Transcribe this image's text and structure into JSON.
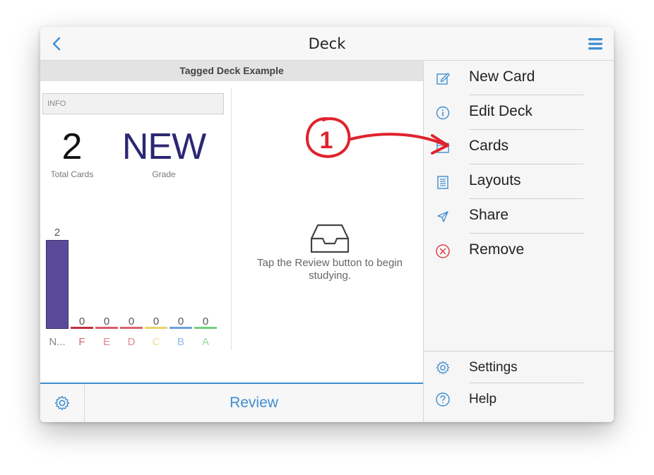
{
  "nav": {
    "title": "Deck",
    "back_icon": "chevron-left-icon",
    "menu_icon": "hamburger-menu-icon",
    "accent": "#3f8ed0"
  },
  "deck": {
    "name": "Tagged Deck Example",
    "info_label": "INFO",
    "total_cards": "2",
    "total_cards_label": "Total Cards",
    "grade": "NEW",
    "grade_label": "Grade"
  },
  "chart_data": {
    "type": "bar",
    "categories": [
      "N...",
      "F",
      "E",
      "D",
      "C",
      "B",
      "A"
    ],
    "values": [
      2,
      0,
      0,
      0,
      0,
      0,
      0
    ],
    "colors": [
      "#5b4a99",
      "#c0303c",
      "#d4606b",
      "#d9646b",
      "#e8d36a",
      "#6aa3e0",
      "#6fd07a"
    ],
    "ylim": [
      0,
      2
    ],
    "title": "",
    "xlabel": "",
    "ylabel": ""
  },
  "empty_state": {
    "icon": "inbox-tray-icon",
    "text": "Tap the Review button to begin studying."
  },
  "bottom_bar": {
    "settings_icon": "gear-icon",
    "review_label": "Review"
  },
  "menu": {
    "items": [
      {
        "label": "New Card",
        "icon": "edit-icon"
      },
      {
        "label": "Edit Deck",
        "icon": "info-icon"
      },
      {
        "label": "Cards",
        "icon": "card-icon"
      },
      {
        "label": "Layouts",
        "icon": "layouts-icon"
      },
      {
        "label": "Share",
        "icon": "send-icon"
      },
      {
        "label": "Remove",
        "icon": "remove-icon"
      }
    ],
    "bottom_items": [
      {
        "label": "Settings",
        "icon": "gear-icon"
      },
      {
        "label": "Help",
        "icon": "help-icon"
      }
    ],
    "remove_color": "#e0414a"
  },
  "annotation": {
    "number": "1",
    "color": "#e0222c"
  }
}
